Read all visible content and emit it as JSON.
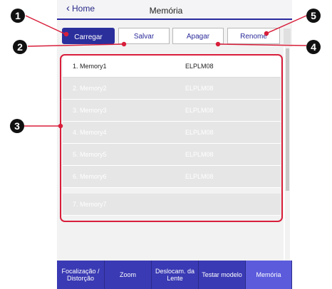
{
  "header": {
    "back_label": "Home",
    "title": "Memória"
  },
  "toolbar": {
    "load_label": "Carregar",
    "save_label": "Salvar",
    "erase_label": "Apagar",
    "rename_label": "Renome"
  },
  "memory_list": [
    {
      "name": "1. Memory1",
      "model": "ELPLM08"
    },
    {
      "name": "2. Memory2",
      "model": "ELPLM08"
    },
    {
      "name": "3. Memory3",
      "model": "ELPLM08"
    },
    {
      "name": "4. Memory4",
      "model": "ELPLM08"
    },
    {
      "name": "5. Memory5",
      "model": "ELPLM08"
    },
    {
      "name": "6. Memory6",
      "model": "ELPLM08"
    },
    {
      "name": "7. Memory7",
      "model": ""
    }
  ],
  "tabs": [
    {
      "label": "Focalização / Distorção"
    },
    {
      "label": "Zoom"
    },
    {
      "label": "Deslocam. da Lente"
    },
    {
      "label": "Testar modelo"
    },
    {
      "label": "Memória"
    }
  ],
  "callouts": [
    "1",
    "2",
    "3",
    "4",
    "5"
  ],
  "colors": {
    "accent": "#2b2f9c",
    "highlight": "#d81e3a",
    "tab_active": "#5b5bdc"
  }
}
